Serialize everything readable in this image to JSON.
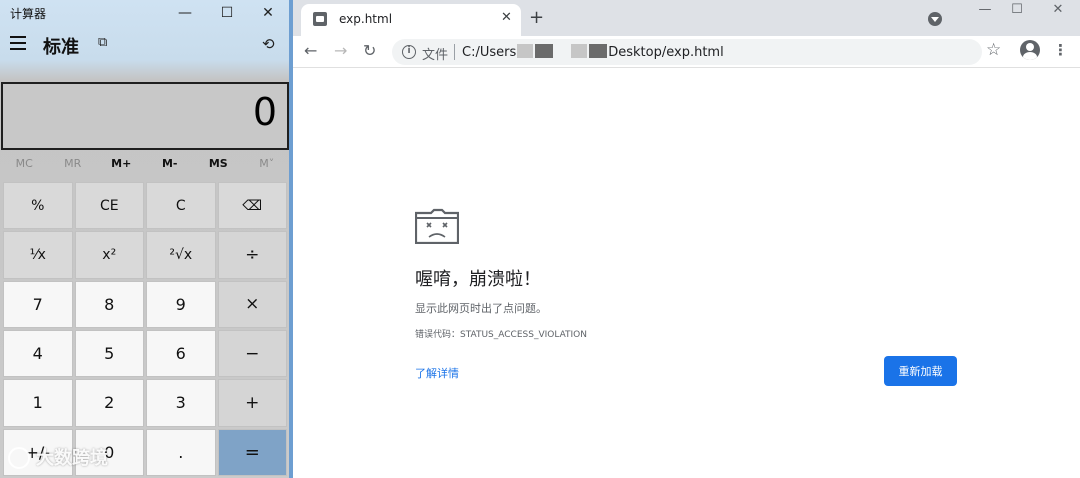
{
  "calculator": {
    "title": "计算器",
    "window_controls": {
      "minimize": "—",
      "maximize": "☐",
      "close": "✕"
    },
    "mode": "标准",
    "compact_glyph": "⧉",
    "history_glyph": "⟲",
    "display_value": "0",
    "memory": [
      {
        "label": "MC",
        "enabled": false
      },
      {
        "label": "MR",
        "enabled": false
      },
      {
        "label": "M+",
        "enabled": true
      },
      {
        "label": "M-",
        "enabled": true
      },
      {
        "label": "MS",
        "enabled": true
      },
      {
        "label": "M˅",
        "enabled": false
      }
    ],
    "keys": [
      {
        "label": "%",
        "name": "percent-key",
        "kind": "fn"
      },
      {
        "label": "CE",
        "name": "clear-entry-key",
        "kind": "fn"
      },
      {
        "label": "C",
        "name": "clear-key",
        "kind": "fn"
      },
      {
        "label": "⌫",
        "name": "backspace-key",
        "kind": "fn"
      },
      {
        "label": "⅟x",
        "name": "reciprocal-key",
        "kind": "fn"
      },
      {
        "label": "x²",
        "name": "square-key",
        "kind": "fn"
      },
      {
        "label": "²√x",
        "name": "square-root-key",
        "kind": "fn"
      },
      {
        "label": "÷",
        "name": "divide-key",
        "kind": "op"
      },
      {
        "label": "7",
        "name": "digit-7-key",
        "kind": "num"
      },
      {
        "label": "8",
        "name": "digit-8-key",
        "kind": "num"
      },
      {
        "label": "9",
        "name": "digit-9-key",
        "kind": "num"
      },
      {
        "label": "×",
        "name": "multiply-key",
        "kind": "op"
      },
      {
        "label": "4",
        "name": "digit-4-key",
        "kind": "num"
      },
      {
        "label": "5",
        "name": "digit-5-key",
        "kind": "num"
      },
      {
        "label": "6",
        "name": "digit-6-key",
        "kind": "num"
      },
      {
        "label": "−",
        "name": "subtract-key",
        "kind": "op"
      },
      {
        "label": "1",
        "name": "digit-1-key",
        "kind": "num"
      },
      {
        "label": "2",
        "name": "digit-2-key",
        "kind": "num"
      },
      {
        "label": "3",
        "name": "digit-3-key",
        "kind": "num"
      },
      {
        "label": "+",
        "name": "add-key",
        "kind": "op"
      },
      {
        "label": "+/-",
        "name": "negate-key",
        "kind": "num"
      },
      {
        "label": "0",
        "name": "digit-0-key",
        "kind": "num"
      },
      {
        "label": ".",
        "name": "decimal-key",
        "kind": "num"
      },
      {
        "label": "=",
        "name": "equals-key",
        "kind": "eq"
      }
    ]
  },
  "browser": {
    "tab": {
      "title": "exp.html",
      "close": "✕"
    },
    "new_tab": "+",
    "window_controls": {
      "minimize": "—",
      "maximize": "☐",
      "close": "✕"
    },
    "nav": {
      "back": "←",
      "forward": "→",
      "reload": "↻"
    },
    "address": {
      "info_glyph": "i",
      "scheme_label": "文件",
      "url_prefix": "C:/Users",
      "url_suffix": "Desktop/exp.html"
    },
    "star": "☆",
    "menu": "⋮",
    "crash_page": {
      "heading": "喔唷，崩溃啦！",
      "message": "显示此网页时出了点问题。",
      "error_code": "错误代码：STATUS_ACCESS_VIOLATION",
      "learn_more": "了解详情",
      "reload_button": "重新加载"
    }
  },
  "watermark": "大数跨境"
}
